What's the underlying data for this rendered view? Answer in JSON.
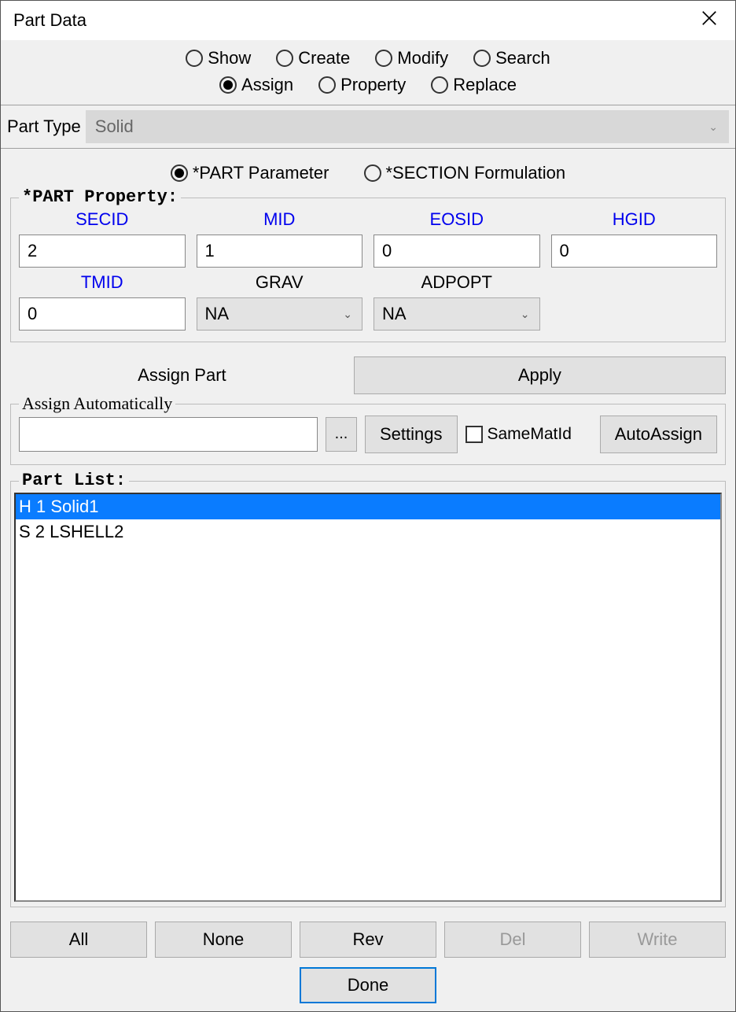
{
  "title": "Part Data",
  "radios_top": {
    "row1": [
      {
        "label": "Show",
        "checked": false
      },
      {
        "label": "Create",
        "checked": false
      },
      {
        "label": "Modify",
        "checked": false
      },
      {
        "label": "Search",
        "checked": false
      }
    ],
    "row2": [
      {
        "label": "Assign",
        "checked": true
      },
      {
        "label": "Property",
        "checked": false
      },
      {
        "label": "Replace",
        "checked": false
      }
    ]
  },
  "part_type": {
    "label": "Part Type",
    "value": "Solid"
  },
  "param_radios": [
    {
      "label": "*PART Parameter",
      "checked": true
    },
    {
      "label": "*SECTION Formulation",
      "checked": false
    }
  ],
  "part_property": {
    "legend": "*PART Property:",
    "cols": [
      {
        "name": "SECID",
        "link": true,
        "value": "2"
      },
      {
        "name": "MID",
        "link": true,
        "value": "1"
      },
      {
        "name": "EOSID",
        "link": true,
        "value": "0"
      },
      {
        "name": "HGID",
        "link": true,
        "value": "0"
      },
      {
        "name": "TMID",
        "link": true,
        "value": "0"
      },
      {
        "name": "GRAV",
        "link": false,
        "value": "NA",
        "select": true
      },
      {
        "name": "ADPOPT",
        "link": false,
        "value": "NA",
        "select": true
      }
    ]
  },
  "assign_part_label": "Assign Part",
  "apply_label": "Apply",
  "auto": {
    "legend": "Assign Automatically",
    "dots": "...",
    "settings": "Settings",
    "samemat": "SameMatId",
    "autoassign": "AutoAssign"
  },
  "part_list": {
    "legend": "Part List:",
    "items": [
      {
        "text": "H 1 Solid1",
        "selected": true
      },
      {
        "text": "S 2 LSHELL2",
        "selected": false
      }
    ]
  },
  "buttons": {
    "all": "All",
    "none": "None",
    "rev": "Rev",
    "del": "Del",
    "write": "Write",
    "done": "Done"
  }
}
